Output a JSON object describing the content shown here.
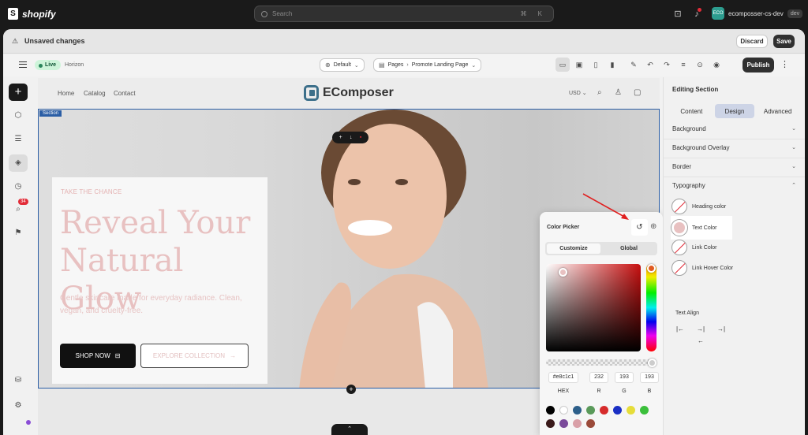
{
  "topbar": {
    "brand": "shopify",
    "search_placeholder": "Search",
    "search_shortcut": "⌘ K",
    "store_initials": "ECO",
    "store_name": "ecomposser-cs-dev",
    "store_tag": "dev"
  },
  "unsaved": {
    "label": "Unsaved changes",
    "discard": "Discard",
    "save": "Save"
  },
  "editor": {
    "status": "Live",
    "theme": "Horizon",
    "template": "Default",
    "page_prefix": "Pages",
    "page_name": "Promote Landing Page",
    "publish": "Publish"
  },
  "left_rail": {
    "badge": "34"
  },
  "store": {
    "nav": [
      "Home",
      "Catalog",
      "Contact"
    ],
    "brand": "EComposer",
    "currency": "USD"
  },
  "hero": {
    "section_tag": "Section",
    "eyebrow": "TAKE THE CHANCE",
    "headline": "Reveal Your Natural Glow",
    "subline": "Gentle skincare made for everyday radiance. Clean, vegan, and cruelty-free.",
    "primary_cta": "SHOP NOW",
    "secondary_cta": "EXPLORE COLLECTION",
    "headline_color": "#e8c1c1"
  },
  "color_picker": {
    "title": "Color Picker",
    "tabs": [
      "Customize",
      "Global"
    ],
    "active_tab": "Customize",
    "hex": "#e8c1c1",
    "r": "232",
    "g": "193",
    "b": "193",
    "labels": [
      "HEX",
      "R",
      "G",
      "B"
    ],
    "alpha_fraction": 1.0,
    "swatches": [
      "#000000",
      "#ffffff",
      "#2d5f8a",
      "#5a9a5a",
      "#d62b2b",
      "#1a2fc4",
      "#e6dd3a",
      "#3bbf3b",
      "#3a1a1a",
      "#7a4a9a",
      "#d9a0a8",
      "#9a4a3a"
    ]
  },
  "right_panel": {
    "title": "Editing Section",
    "tabs": [
      "Content",
      "Design",
      "Advanced"
    ],
    "active_tab": "Design",
    "sections": [
      "Background",
      "Background Overlay",
      "Border",
      "Typography"
    ],
    "typography": {
      "heading_color": "Heading color",
      "text_color": "Text Color",
      "link_color": "Link Color",
      "link_hover_color": "Link Hover Color",
      "text_align": "Text Align"
    },
    "text_color_value": "#e8c1c1"
  },
  "colors": {
    "accent_blue": "#2b5ea5",
    "annotation_arrow": "#e02020"
  }
}
